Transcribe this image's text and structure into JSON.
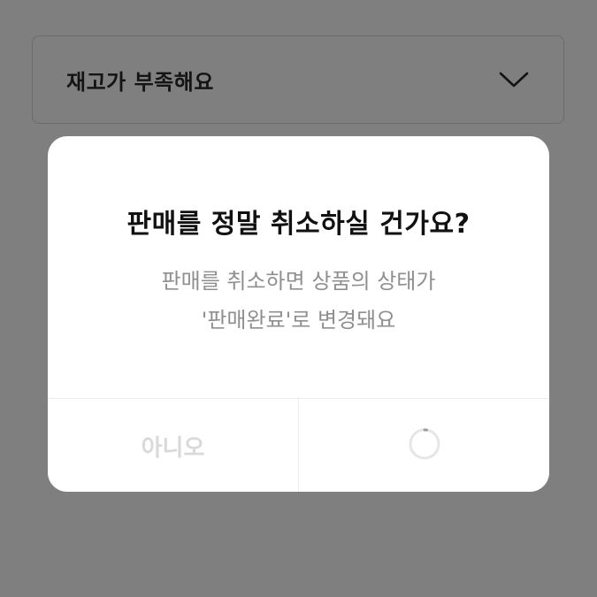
{
  "dropdown": {
    "selected_value": "재고가 부족해요",
    "icon": "chevron-down-icon"
  },
  "dialog": {
    "title": "판매를 정말 취소하실 건가요?",
    "message_line1": "판매를 취소하면 상품의 상태가",
    "message_line2": "'판매완료'로 변경돼요",
    "no_label": "아니오",
    "confirm_icon": "loading-spinner-icon"
  },
  "colors": {
    "overlay": "#7f7f7f",
    "dialog_bg": "#ffffff",
    "title_text": "#111111",
    "message_text": "#8f8f8f",
    "disabled_text": "#d9d9d9"
  }
}
